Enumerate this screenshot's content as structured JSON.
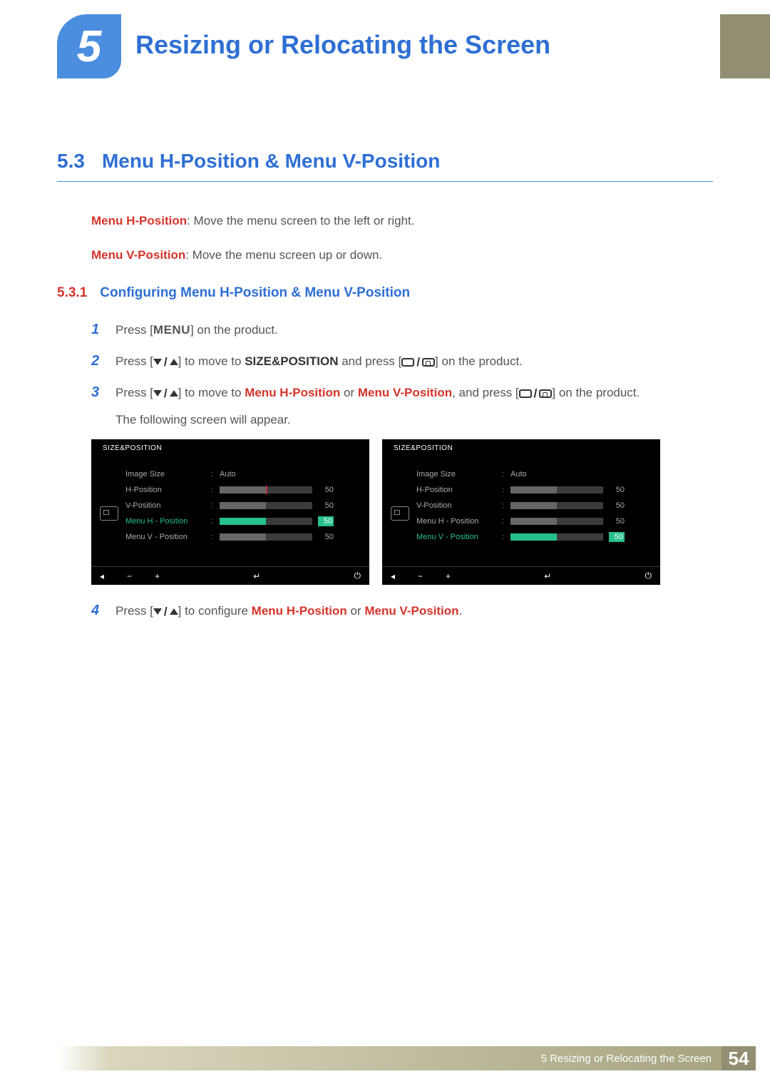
{
  "header": {
    "chapter_number": "5",
    "chapter_title": "Resizing or Relocating the Screen"
  },
  "section": {
    "number": "5.3",
    "title": "Menu H-Position & Menu V-Position"
  },
  "descriptions": {
    "h_label": "Menu H-Position",
    "h_text": ": Move the menu screen to the left or right.",
    "v_label": "Menu V-Position",
    "v_text": ": Move the menu screen up or down."
  },
  "subsection": {
    "number": "5.3.1",
    "title": "Configuring Menu H-Position & Menu V-Position"
  },
  "steps": {
    "s1_a": "Press [",
    "s1_menu": "MENU",
    "s1_b": "] on the product.",
    "s2_a": "Press [",
    "s2_b": "] to move to ",
    "s2_target": "SIZE&POSITION",
    "s2_c": " and press [",
    "s2_d": "] on the product.",
    "s3_a": "Press [",
    "s3_b": "] to move to ",
    "s3_t1": "Menu H-Position",
    "s3_or1": " or ",
    "s3_t2": "Menu V-Position",
    "s3_c": ", and press [",
    "s3_d": "] on the product.",
    "s3_note": "The following screen will appear.",
    "s4_a": "Press [",
    "s4_b": "] to configure ",
    "s4_t1": "Menu H-Position",
    "s4_or": " or ",
    "s4_t2": "Menu V-Position",
    "s4_c": "."
  },
  "osd": {
    "title": "SIZE&POSITION",
    "items": {
      "image_size": "Image Size",
      "auto": "Auto",
      "h_pos": "H-Position",
      "v_pos": "V-Position",
      "menu_h": "Menu H - Position",
      "menu_v": "Menu V - Position",
      "val50": "50"
    }
  },
  "footer": {
    "chapter_ref": "5 Resizing or Relocating the Screen",
    "page": "54"
  }
}
